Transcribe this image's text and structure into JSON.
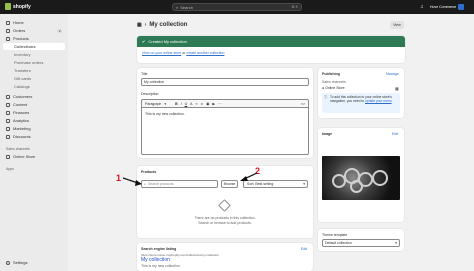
{
  "topbar": {
    "brand": "shopify",
    "search_placeholder": "Search",
    "search_shortcut": "⌘ K",
    "store_name": "Hove Commerce"
  },
  "sidebar": {
    "items": [
      {
        "label": "Home",
        "badge": ""
      },
      {
        "label": "Orders",
        "badge": "2"
      },
      {
        "label": "Products",
        "badge": ""
      },
      {
        "label": "Collections",
        "badge": ""
      },
      {
        "label": "Inventory",
        "badge": ""
      },
      {
        "label": "Purchase orders",
        "badge": ""
      },
      {
        "label": "Transfers",
        "badge": ""
      },
      {
        "label": "Gift cards",
        "badge": ""
      },
      {
        "label": "Catalogs",
        "badge": ""
      },
      {
        "label": "Customers",
        "badge": ""
      },
      {
        "label": "Content",
        "badge": ""
      },
      {
        "label": "Finances",
        "badge": ""
      },
      {
        "label": "Analytics",
        "badge": ""
      },
      {
        "label": "Marketing",
        "badge": ""
      },
      {
        "label": "Discounts",
        "badge": ""
      }
    ],
    "sales_channels_header": "Sales channels",
    "online_store": "Online Store",
    "apps_header": "Apps",
    "settings": "Settings"
  },
  "page": {
    "title": "My collection",
    "view_button": "View"
  },
  "banner": {
    "message": "Created My collection",
    "link1": "View on your online store",
    "or": " or ",
    "link2": "create another collection"
  },
  "form": {
    "title_label": "Title",
    "title_value": "My collection",
    "description_label": "Description",
    "paragraph_select": "Paragraph",
    "description_text": "This is my new collection."
  },
  "products": {
    "header": "Products",
    "search_placeholder": "Search products",
    "browse": "Browse",
    "sort_label": "Sort: Best selling",
    "empty_line1": "There are no products in this collection.",
    "empty_line2": "Search or browse to add products.",
    "annotation1": "1",
    "annotation2": "2"
  },
  "seo": {
    "header": "Search engine listing",
    "edit": "Edit",
    "url": "https://store-name.myshopify.com/collections/my-collection",
    "title": "My collection",
    "desc": "This is my new collection."
  },
  "publishing": {
    "header": "Publishing",
    "manage": "Manage",
    "channels_label": "Sales channels",
    "online_store": "Online Store",
    "info": "To add this collection to your online store's navigation, you need to",
    "info_link": "update your menu"
  },
  "image": {
    "header": "Image",
    "edit": "Edit"
  },
  "theme": {
    "label": "Theme template",
    "value": "Default collection"
  }
}
